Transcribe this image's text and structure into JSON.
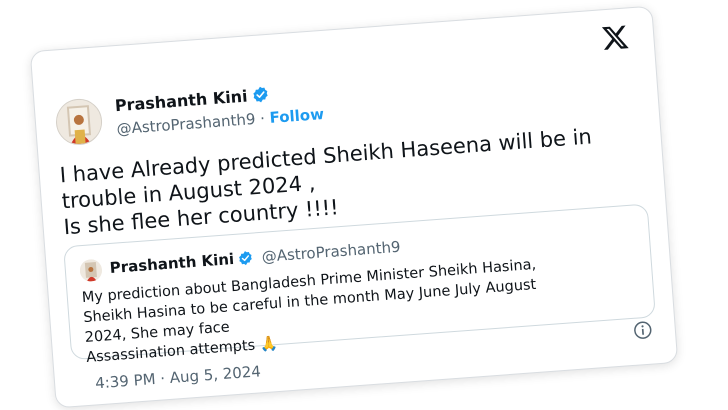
{
  "author": {
    "name": "Prashanth Kini",
    "handle": "@AstroPrashanth9",
    "separator": "·",
    "follow_label": "Follow"
  },
  "tweet": {
    "lines": [
      "I have Already predicted Sheikh Haseena will be in",
      "trouble in August 2024 ,",
      "Is she flee her country !!!!"
    ],
    "timestamp": "4:39 PM · Aug 5, 2024"
  },
  "quoted_tweet": {
    "name": "Prashanth Kini",
    "handle": "@AstroPrashanth9",
    "lines": [
      "My prediction about Bangladesh Prime Minister Sheikh Hasina,",
      "Sheikh Hasina to be careful in the month May June July August",
      "2024, She may face",
      "Assassination attempts 🙏"
    ]
  },
  "icons": {
    "brand": "x-logo-icon",
    "verified": "verified-badge-icon",
    "info": "info-icon"
  },
  "colors": {
    "accent": "#1d9bf0",
    "text": "#0f1419",
    "muted": "#536471",
    "border": "#cfd9de"
  }
}
